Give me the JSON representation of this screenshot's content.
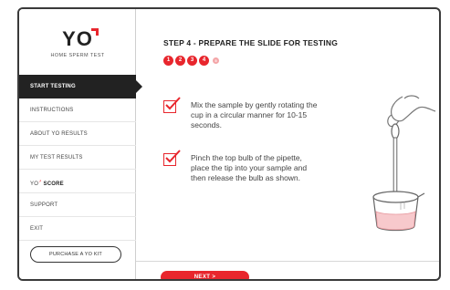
{
  "brand": {
    "logo_text": "YO",
    "subtitle": "HOME SPERM TEST",
    "accent_color": "#e8262d"
  },
  "sidebar": {
    "items": [
      {
        "label": "START TESTING",
        "active": true
      },
      {
        "label": "INSTRUCTIONS",
        "active": false
      },
      {
        "label": "ABOUT YO RESULTS",
        "active": false
      },
      {
        "label": "MY TEST RESULTS",
        "active": false
      },
      {
        "label_prefix": "YO",
        "label_strong": "SCORE",
        "active": false
      },
      {
        "label": "SUPPORT",
        "active": false
      },
      {
        "label": "EXIT",
        "active": false
      }
    ],
    "purchase_label": "PURCHASE A YO KIT"
  },
  "main": {
    "step_title": "STEP 4 - PREPARE THE SLIDE FOR TESTING",
    "progress": {
      "completed": [
        "1",
        "2",
        "3",
        "4"
      ],
      "pending": [
        "5"
      ],
      "current_step": 4,
      "total_steps": 5
    },
    "instructions": [
      {
        "text": "Mix the sample by gently rotating the cup in a circular manner for 10-15 seconds.",
        "checked": true
      },
      {
        "text": "Pinch the top bulb of the pipette, place the tip into your sample and then release the bulb as shown.",
        "checked": true
      }
    ],
    "illustration_icon": "pipette-cup-icon",
    "next_label": "NEXT >"
  }
}
